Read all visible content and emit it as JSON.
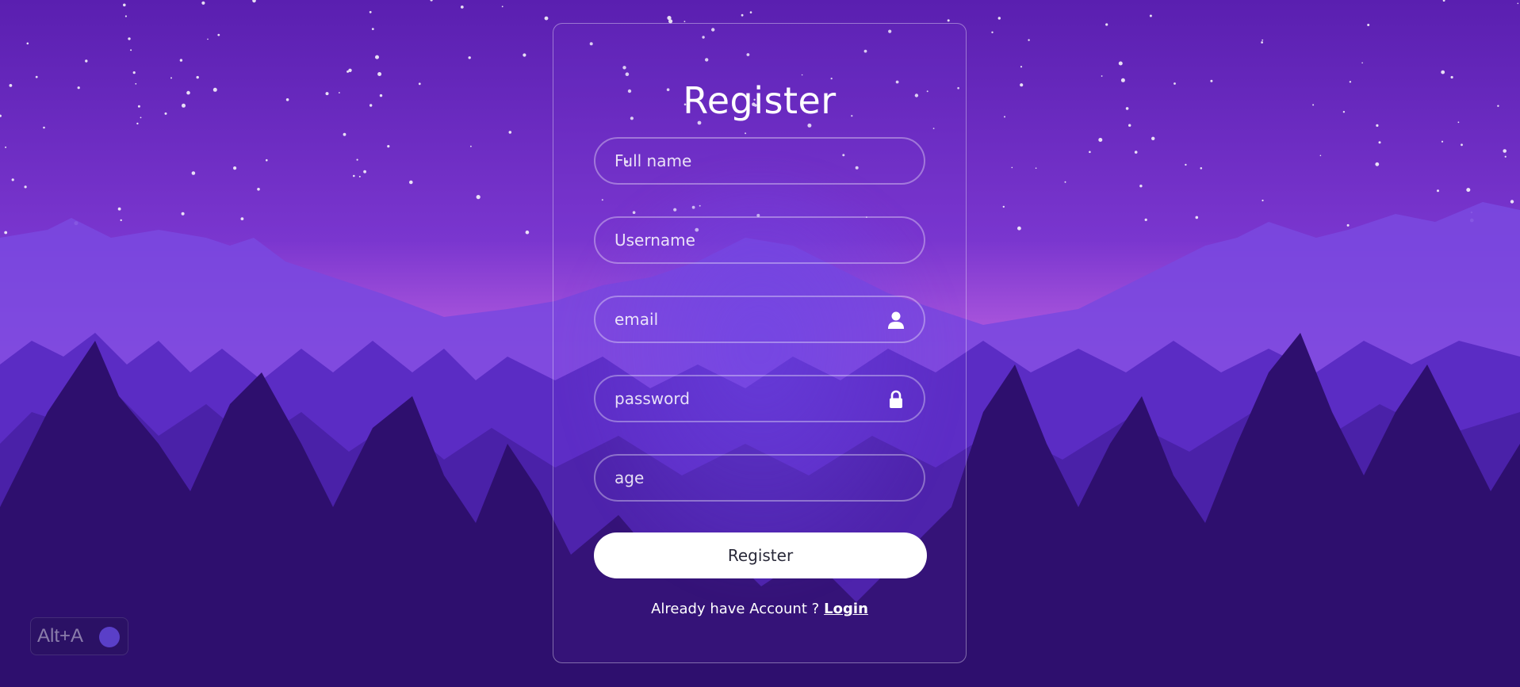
{
  "form": {
    "title": "Register",
    "fields": {
      "full_name": {
        "placeholder": "Full name"
      },
      "username": {
        "placeholder": "Username"
      },
      "email": {
        "placeholder": "email",
        "icon": "user-icon"
      },
      "password": {
        "placeholder": "password",
        "icon": "lock-icon"
      },
      "age": {
        "placeholder": "age"
      }
    },
    "submit_label": "Register",
    "footer_text": "Already have Account ?",
    "login_link": "Login"
  },
  "overlay": {
    "shortcut_label": "Alt+A",
    "icon": "audio-wave-icon"
  },
  "colors": {
    "sky_top": "#5a1fb0",
    "sky_horizon": "#b75ee0",
    "forest_dark": "#2e0f6e",
    "button_bg": "#ffffff"
  }
}
